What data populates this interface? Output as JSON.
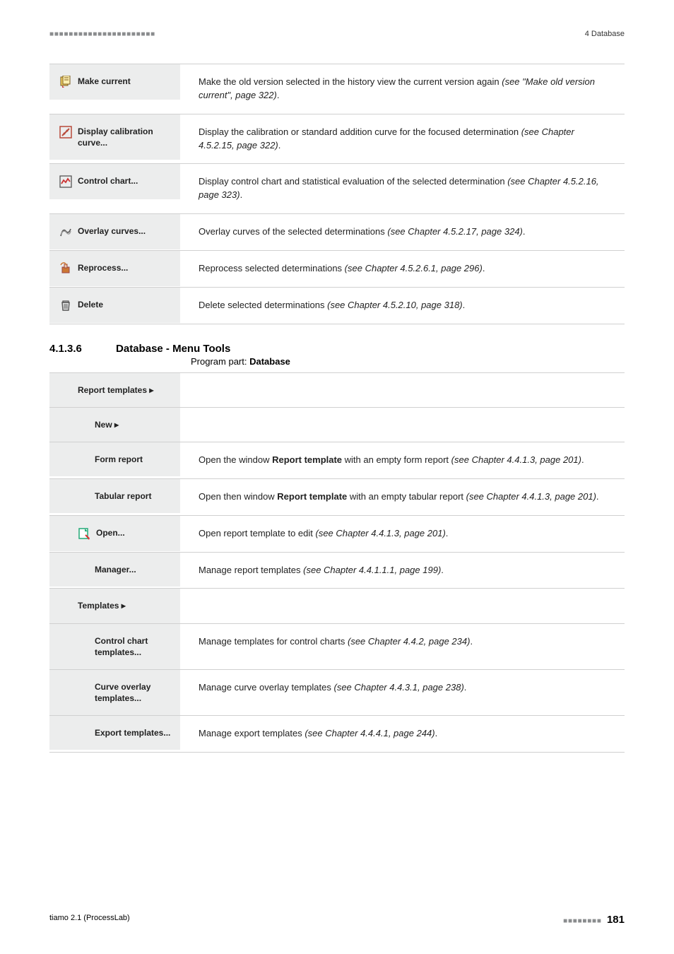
{
  "header": {
    "dashes": "■ ■ ■ ■ ■ ■ ■ ■ ■ ■ ■ ■ ■ ■ ■ ■ ■ ■ ■ ■ ■ ■",
    "chapter": "4 Database"
  },
  "section1": {
    "rows": [
      {
        "icon": "make-current-icon",
        "label": "Make current",
        "desc_pre": "Make the old version selected in the history view the current version again ",
        "desc_italic": "(see \"Make old version current\", page 322)",
        "desc_post": "."
      },
      {
        "icon": "calibration-icon",
        "label": "Display calibration curve...",
        "desc_pre": "Display the calibration or standard addition curve for the focused determination ",
        "desc_italic": "(see Chapter 4.5.2.15, page 322)",
        "desc_post": "."
      },
      {
        "icon": "control-chart-icon",
        "label": "Control chart...",
        "desc_pre": "Display control chart and statistical evaluation of the selected determination ",
        "desc_italic": "(see Chapter 4.5.2.16, page 323)",
        "desc_post": "."
      },
      {
        "icon": "overlay-curves-icon",
        "label": "Overlay curves...",
        "desc_pre": "Overlay curves of the selected determinations ",
        "desc_italic": "(see Chapter 4.5.2.17, page 324)",
        "desc_post": "."
      },
      {
        "icon": "reprocess-icon",
        "label": "Reprocess...",
        "desc_pre": "Reprocess selected determinations ",
        "desc_italic": "(see Chapter 4.5.2.6.1, page 296)",
        "desc_post": "."
      },
      {
        "icon": "delete-icon",
        "label": "Delete",
        "desc_pre": "Delete selected determinations ",
        "desc_italic": "(see Chapter 4.5.2.10, page 318)",
        "desc_post": "."
      }
    ]
  },
  "section2": {
    "number": "4.1.3.6",
    "title": "Database - Menu Tools",
    "program_part_prefix": "Program part: ",
    "program_part": "Database",
    "rows": [
      {
        "type": "group",
        "indent": "sub1",
        "label": "Report templates ▸"
      },
      {
        "type": "group",
        "indent": "sub2",
        "label": "New ▸"
      },
      {
        "type": "item",
        "indent": "sub2",
        "icon": null,
        "label": "Form report",
        "desc_pre": "Open the window ",
        "desc_bold": "Report template",
        "desc_mid": " with an empty form report ",
        "desc_italic": "(see Chapter 4.4.1.3, page 201)",
        "desc_post": "."
      },
      {
        "type": "item",
        "indent": "sub2",
        "icon": null,
        "label": "Tabular report",
        "desc_pre": "Open then window ",
        "desc_bold": "Report template",
        "desc_mid": " with an empty tabular report ",
        "desc_italic": "(see Chapter 4.4.1.3, page 201)",
        "desc_post": "."
      },
      {
        "type": "item",
        "indent": "sub1",
        "icon": "open-icon",
        "label": "Open...",
        "desc_pre": "Open report template to edit ",
        "desc_bold": "",
        "desc_mid": "",
        "desc_italic": "(see Chapter 4.4.1.3, page 201)",
        "desc_post": "."
      },
      {
        "type": "item",
        "indent": "sub2",
        "icon": null,
        "label": "Manager...",
        "desc_pre": "Manage report templates ",
        "desc_bold": "",
        "desc_mid": "",
        "desc_italic": "(see Chapter 4.4.1.1.1, page 199)",
        "desc_post": "."
      },
      {
        "type": "group",
        "indent": "sub1",
        "label": "Templates ▸"
      },
      {
        "type": "item",
        "indent": "sub2",
        "icon": null,
        "label": "Control chart templates...",
        "desc_pre": "Manage templates for control charts ",
        "desc_bold": "",
        "desc_mid": "",
        "desc_italic": "(see Chapter 4.4.2, page 234)",
        "desc_post": "."
      },
      {
        "type": "item",
        "indent": "sub2",
        "icon": null,
        "label": "Curve overlay templates...",
        "desc_pre": "Manage curve overlay templates ",
        "desc_bold": "",
        "desc_mid": "",
        "desc_italic": "(see Chapter 4.4.3.1, page 238)",
        "desc_post": "."
      },
      {
        "type": "item",
        "indent": "sub2",
        "icon": null,
        "label": "Export tem­plates...",
        "desc_pre": "Manage export templates ",
        "desc_bold": "",
        "desc_mid": "",
        "desc_italic": "(see Chapter 4.4.4.1, page 244)",
        "desc_post": "."
      }
    ]
  },
  "footer": {
    "product": "tiamo 2.1 (ProcessLab)",
    "dashes": "■ ■ ■ ■ ■ ■ ■ ■",
    "page_number": "181"
  },
  "icons": {
    "make-current-icon": "svg_make_current",
    "calibration-icon": "svg_calibration",
    "control-chart-icon": "svg_control_chart",
    "overlay-curves-icon": "svg_overlay",
    "reprocess-icon": "svg_reprocess",
    "delete-icon": "svg_trash",
    "open-icon": "svg_open"
  }
}
